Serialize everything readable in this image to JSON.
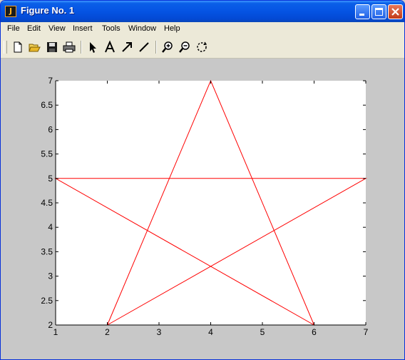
{
  "window": {
    "title": "Figure No. 1",
    "app_icon_glyph": "J"
  },
  "menu": [
    "File",
    "Edit",
    "View",
    "Insert",
    "Tools",
    "Window",
    "Help"
  ],
  "toolbar": [
    "new-figure-icon",
    "open-file-icon",
    "save-icon",
    "print-icon",
    "edit-plot-arrow-icon",
    "insert-text-icon",
    "insert-arrow-icon",
    "insert-line-icon",
    "zoom-in-icon",
    "zoom-out-icon",
    "rotate-3d-icon"
  ],
  "colors": {
    "line": "#ff0000",
    "axes_background": "#ffffff",
    "figure_background": "#c8c8c8",
    "titlebar": "#0554e3"
  },
  "chart_data": {
    "type": "line",
    "series": [
      {
        "x": [
          2,
          4,
          6,
          1,
          7,
          2
        ],
        "y": [
          2,
          7,
          2,
          5,
          5,
          2
        ]
      }
    ],
    "xlim": [
      1,
      7
    ],
    "ylim": [
      2,
      7
    ],
    "xticks": [
      1,
      2,
      3,
      4,
      5,
      6,
      7
    ],
    "yticks": [
      2,
      2.5,
      3,
      3.5,
      4,
      4.5,
      5,
      5.5,
      6,
      6.5,
      7
    ],
    "xtick_labels": [
      "1",
      "2",
      "3",
      "4",
      "5",
      "6",
      "7"
    ],
    "ytick_labels": [
      "2",
      "2.5",
      "3",
      "3.5",
      "4",
      "4.5",
      "5",
      "5.5",
      "6",
      "6.5",
      "7"
    ],
    "grid": false
  }
}
